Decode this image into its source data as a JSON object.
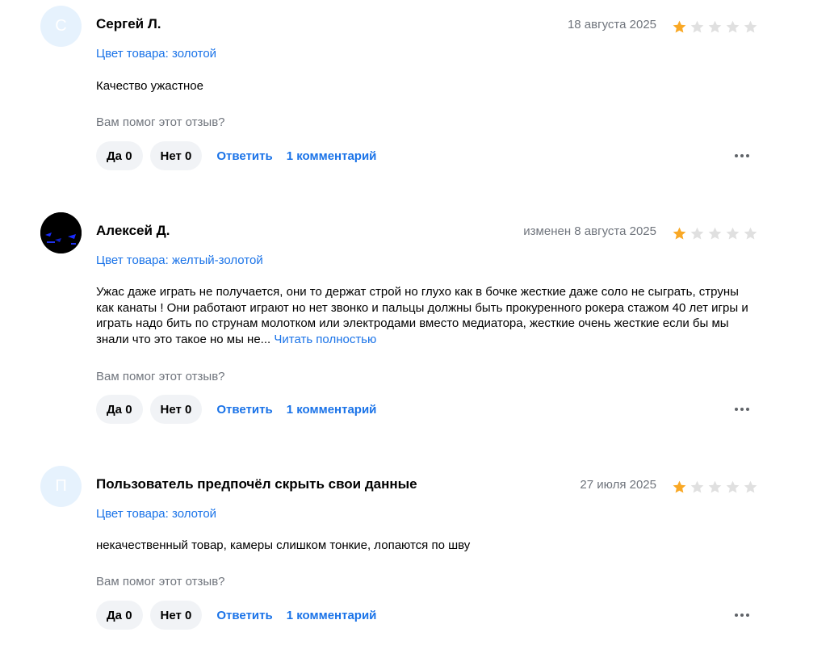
{
  "colors": {
    "accent": "#1a73e8",
    "star_filled": "#f9a825",
    "star_empty": "#e0e0e0",
    "muted": "#70757d"
  },
  "reviews": [
    {
      "avatar_letter": "С",
      "author": "Сергей Л.",
      "date": "18 августа 2025",
      "rating": 1,
      "variant": "Цвет товара: золотой",
      "text": "Качество ужастное",
      "read_more": "",
      "helpful_question": "Вам помог этот отзыв?",
      "yes_label": "Да 0",
      "no_label": "Нет 0",
      "reply_label": "Ответить",
      "comments_label": "1 комментарий"
    },
    {
      "avatar_letter": "",
      "author": "Алексей Д.",
      "date": "изменен 8 августа 2025",
      "rating": 1,
      "variant": "Цвет товара: желтый-золотой",
      "text": "Ужас даже играть не получается, они то держат строй но глухо как в бочке жесткие даже соло не сыграть, струны как канаты ! Они работают играют но нет звонко и пальцы должны быть прокуренного рокера стажом 40 лет игры и играть надо бить по струнам молотком или электродами вместо медиатора, жесткие очень жесткие если бы мы знали что это такое но мы не...",
      "read_more": "Читать полностью",
      "helpful_question": "Вам помог этот отзыв?",
      "yes_label": "Да 0",
      "no_label": "Нет 0",
      "reply_label": "Ответить",
      "comments_label": "1 комментарий"
    },
    {
      "avatar_letter": "П",
      "author": "Пользователь предпочёл скрыть свои данные",
      "date": "27 июля 2025",
      "rating": 1,
      "variant": "Цвет товара: золотой",
      "text": "некачественный товар, камеры слишком тонкие, лопаются по шву",
      "read_more": "",
      "helpful_question": "Вам помог этот отзыв?",
      "yes_label": "Да 0",
      "no_label": "Нет 0",
      "reply_label": "Ответить",
      "comments_label": "1 комментарий"
    }
  ]
}
